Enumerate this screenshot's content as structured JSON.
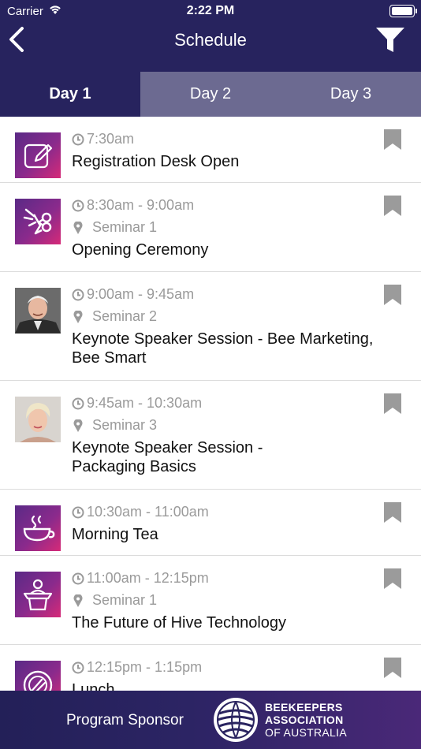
{
  "status_bar": {
    "carrier": "Carrier",
    "time": "2:22 PM"
  },
  "nav": {
    "title": "Schedule"
  },
  "tabs": [
    {
      "label": "Day 1",
      "selected": true
    },
    {
      "label": "Day 2",
      "selected": false
    },
    {
      "label": "Day 3",
      "selected": false
    }
  ],
  "sessions": [
    {
      "time": "7:30am",
      "location": "",
      "title": "Registration Desk Open",
      "thumb": "edit-icon"
    },
    {
      "time": "8:30am - 9:00am",
      "location": "Seminar 1",
      "title": "Opening Ceremony",
      "thumb": "ribbon-cutting-icon"
    },
    {
      "time": "9:00am - 9:45am",
      "location": "Seminar 2",
      "title": "Keynote Speaker Session - Bee Marketing, Bee Smart",
      "thumb": "speaker-photo"
    },
    {
      "time": "9:45am - 10:30am",
      "location": "Seminar 3",
      "title": "Keynote Speaker Session - Packaging Basics",
      "thumb": "speaker-photo"
    },
    {
      "time": "10:30am - 11:00am",
      "location": "",
      "title": "Morning Tea",
      "thumb": "coffee-cup-icon"
    },
    {
      "time": "11:00am - 12:15pm",
      "location": "Seminar 1",
      "title": "The Future of Hive Technology",
      "thumb": "lectern-speaker-icon"
    },
    {
      "time": "12:15pm - 1:15pm",
      "location": "",
      "title": "Lunch",
      "thumb": "plate-cutlery-icon"
    }
  ],
  "footer": {
    "sponsor_label": "Program Sponsor",
    "org_line_1": "BEEKEEPERS",
    "org_line_2": "ASSOCIATION",
    "org_line_3": "OF AUSTRALIA"
  },
  "colors": {
    "header": "#27235e",
    "tab_inactive": "#6c6a91",
    "accent_pink": "#d62a78",
    "accent_purple": "#5a2a86"
  }
}
